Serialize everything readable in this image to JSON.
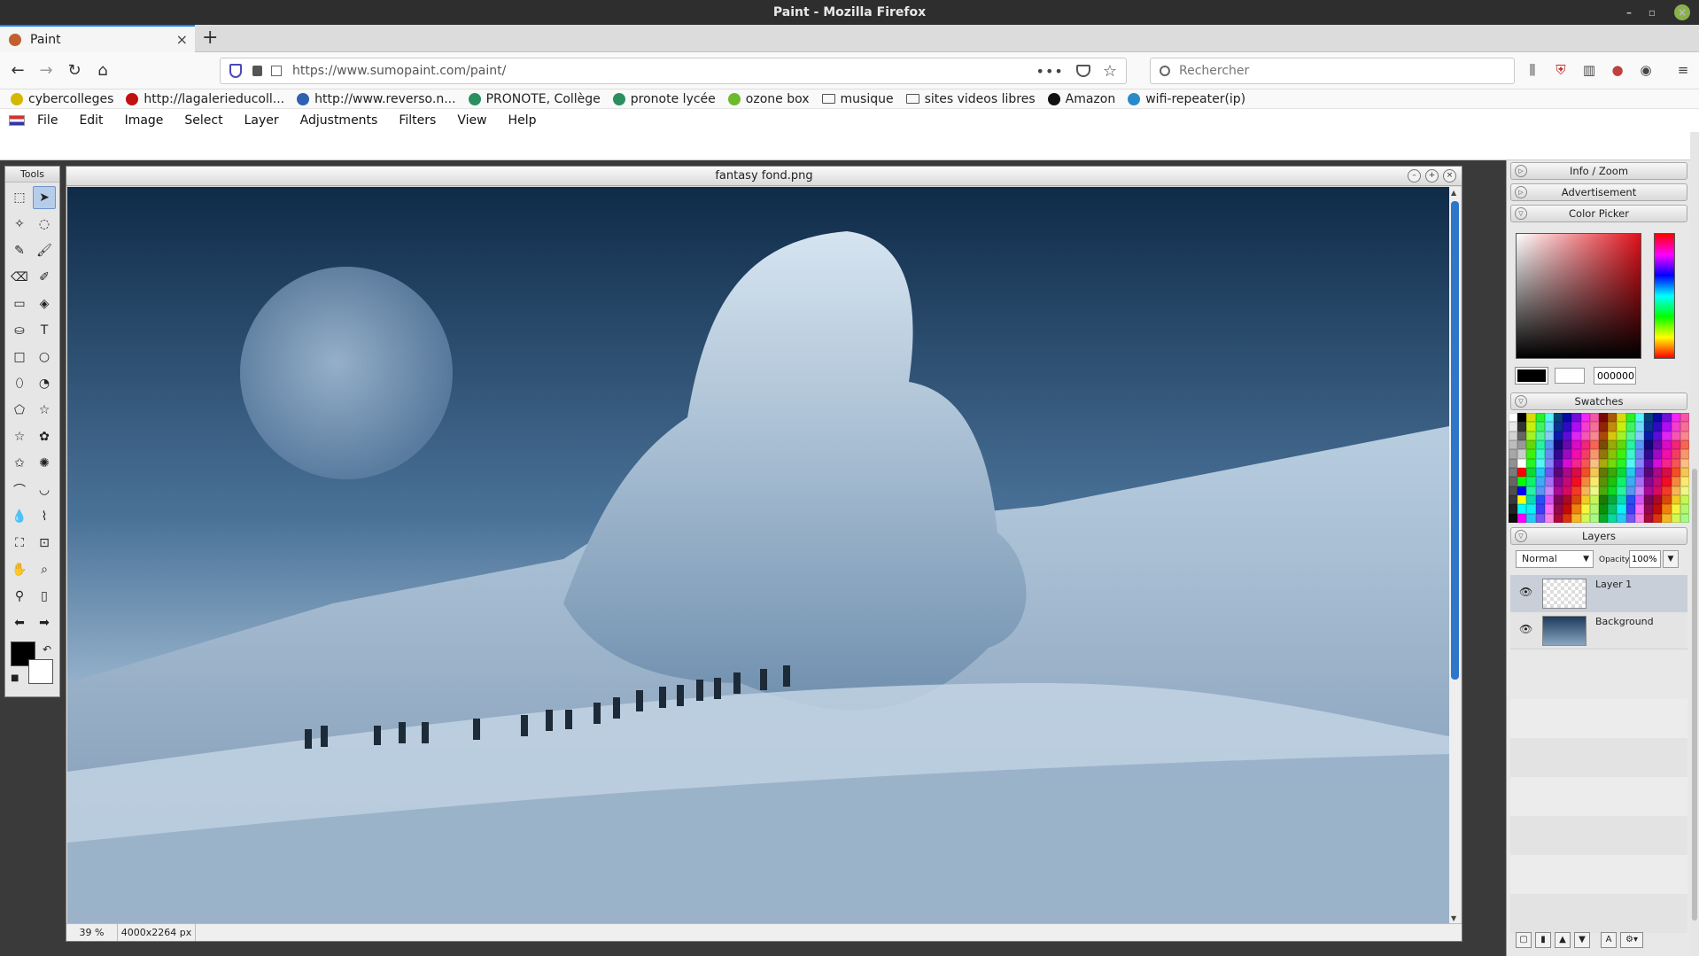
{
  "window": {
    "title": "Paint - Mozilla Firefox",
    "minimize": "–",
    "maximize": "▫",
    "close": "×"
  },
  "tab": {
    "label": "Paint",
    "close": "×",
    "new_tab": "+"
  },
  "nav": {
    "back": "←",
    "forward": "→",
    "reload": "↻",
    "home": "⌂"
  },
  "url": {
    "value": "https://www.sumopaint.com/paint/"
  },
  "search": {
    "placeholder": "Rechercher"
  },
  "bookmarks": [
    {
      "label": "cybercolleges",
      "icon": "college-icon",
      "color": "#d4b800"
    },
    {
      "label": "http://lagalerieducoll...",
      "icon": "f-icon",
      "color": "#c01010"
    },
    {
      "label": "http://www.reverso.n...",
      "icon": "reverso-icon",
      "color": "#3060b0"
    },
    {
      "label": "PRONOTE, Collège",
      "icon": "pronote-icon",
      "color": "#2a8f5e"
    },
    {
      "label": "pronote lycée",
      "icon": "pronote-icon",
      "color": "#2a8f5e"
    },
    {
      "label": "ozone box",
      "icon": "ozone-icon",
      "color": "#6cba2c"
    },
    {
      "label": "musique",
      "icon": "folder-icon"
    },
    {
      "label": "sites videos libres",
      "icon": "folder-icon"
    },
    {
      "label": "Amazon",
      "icon": "amazon-icon",
      "color": "#111111"
    },
    {
      "label": "wifi-repeater(ip)",
      "icon": "wifi-icon",
      "color": "#2a8ac8"
    }
  ],
  "menu": [
    "File",
    "Edit",
    "Image",
    "Select",
    "Layer",
    "Adjustments",
    "Filters",
    "View",
    "Help"
  ],
  "tools": {
    "title": "Tools"
  },
  "document": {
    "title": "fantasy fond.png",
    "zoom": "39 %",
    "size": "4000x2264 px"
  },
  "panels": {
    "info_zoom": "Info / Zoom",
    "advertisement": "Advertisement",
    "color_picker": "Color Picker",
    "hex_value": "000000",
    "swatches": "Swatches",
    "layers": "Layers",
    "blend_mode": "Normal",
    "opacity_label": "Opacity:",
    "opacity_value": "100%"
  },
  "layers": [
    {
      "name": "Layer 1"
    },
    {
      "name": "Background"
    }
  ],
  "colors": {
    "accent": "#0a84ff",
    "foreground": "#000000",
    "background": "#ffffff"
  }
}
